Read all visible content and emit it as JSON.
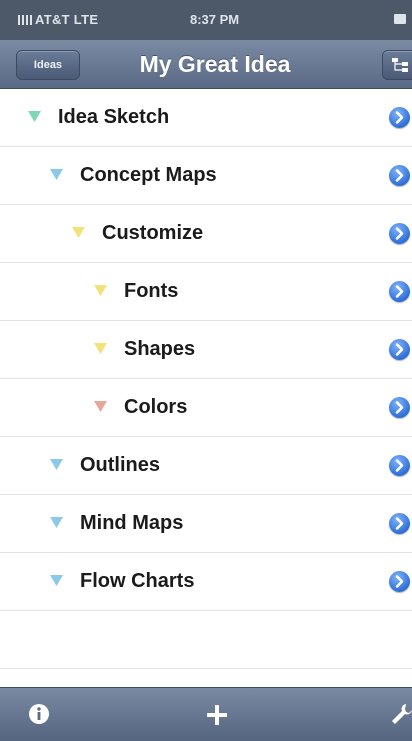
{
  "status_bar": {
    "carrier": "AT&T LTE",
    "time": "8:37 PM"
  },
  "navbar": {
    "back_label": "Ideas",
    "title": "My Great Idea",
    "right_button_icon": "tree-icon"
  },
  "outline": [
    {
      "label": "Idea Sketch",
      "level": 0,
      "color": "#7ed9b3"
    },
    {
      "label": "Concept Maps",
      "level": 1,
      "color": "#8cc8e8"
    },
    {
      "label": "Customize",
      "level": 2,
      "color": "#f2e27a"
    },
    {
      "label": "Fonts",
      "level": 3,
      "color": "#f2e27a"
    },
    {
      "label": "Shapes",
      "level": 3,
      "color": "#f2e27a"
    },
    {
      "label": "Colors",
      "level": 3,
      "color": "#e4a79a"
    },
    {
      "label": "Outlines",
      "level": 1,
      "color": "#8cc8e8"
    },
    {
      "label": "Mind Maps",
      "level": 1,
      "color": "#8cc8e8"
    },
    {
      "label": "Flow Charts",
      "level": 1,
      "color": "#8cc8e8"
    }
  ],
  "toolbar": {
    "info_icon": "info-icon",
    "add_icon": "plus-icon",
    "settings_icon": "wrench-icon"
  }
}
